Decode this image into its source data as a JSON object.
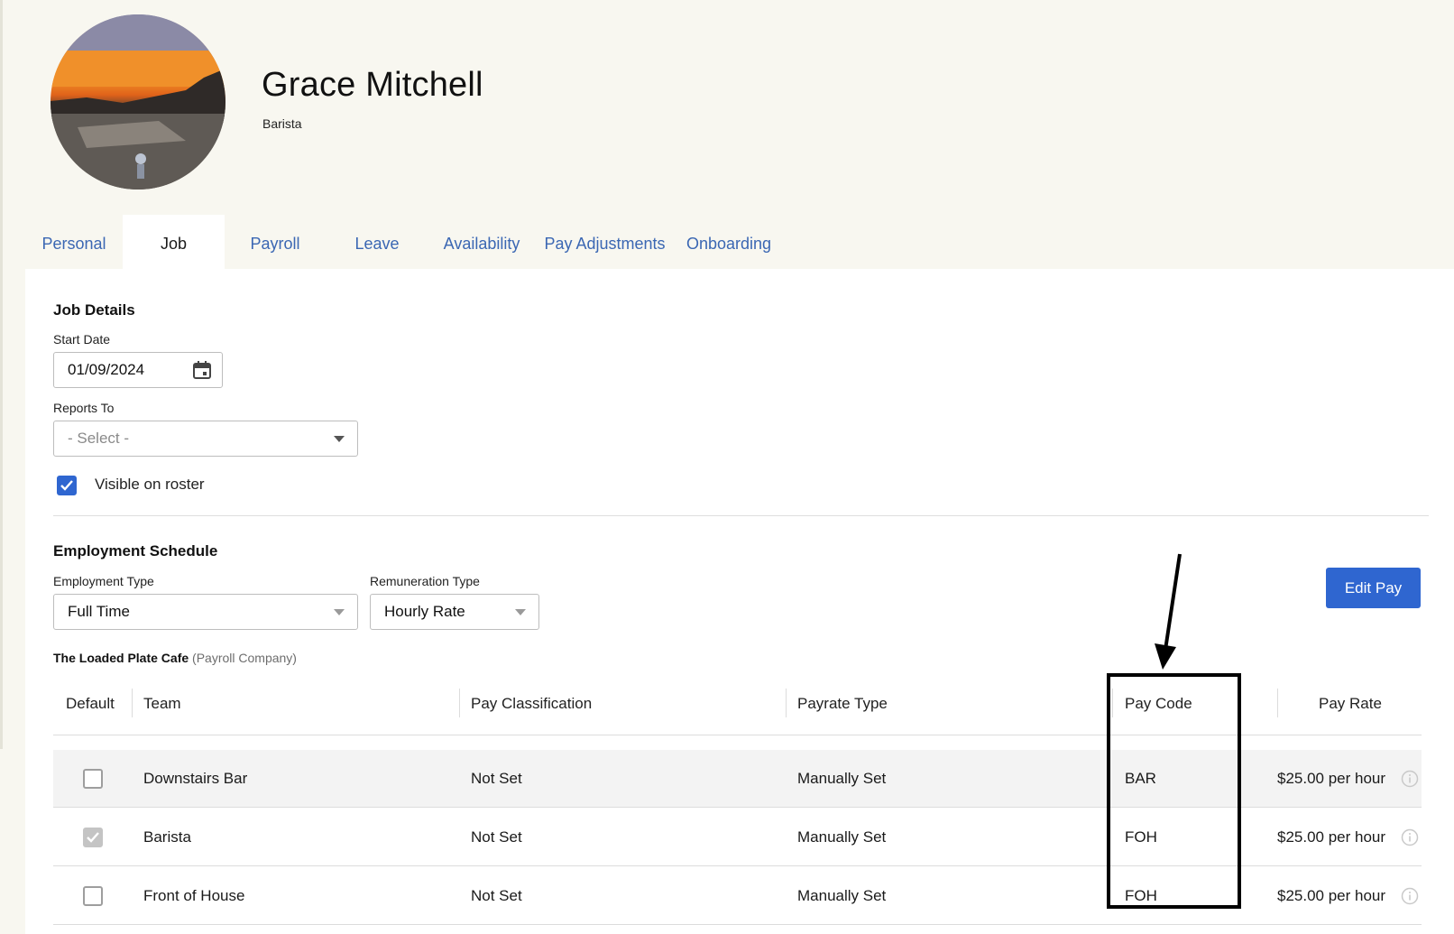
{
  "profile": {
    "name": "Grace Mitchell",
    "role": "Barista",
    "avatar_icon": "camera-add-icon"
  },
  "tabs": [
    {
      "label": "Personal",
      "active": false
    },
    {
      "label": "Job",
      "active": true
    },
    {
      "label": "Payroll",
      "active": false
    },
    {
      "label": "Leave",
      "active": false
    },
    {
      "label": "Availability",
      "active": false
    },
    {
      "label": "Pay Adjustments",
      "active": false
    },
    {
      "label": "Onboarding",
      "active": false
    }
  ],
  "job_details": {
    "title": "Job Details",
    "start_date_label": "Start Date",
    "start_date_value": "01/09/2024",
    "reports_to_label": "Reports To",
    "reports_to_placeholder": "- Select -",
    "visible_on_roster_label": "Visible on roster",
    "visible_on_roster_checked": true
  },
  "employment_schedule": {
    "title": "Employment Schedule",
    "employment_type_label": "Employment Type",
    "employment_type_value": "Full Time",
    "remuneration_type_label": "Remuneration Type",
    "remuneration_type_value": "Hourly Rate",
    "edit_pay_label": "Edit Pay",
    "company_name": "The Loaded Plate Cafe",
    "company_suffix": "(Payroll Company)"
  },
  "table": {
    "headers": {
      "default": "Default",
      "team": "Team",
      "pay_classification": "Pay Classification",
      "payrate_type": "Payrate Type",
      "pay_code": "Pay Code",
      "pay_rate": "Pay Rate"
    },
    "rows": [
      {
        "default": false,
        "default_state": "unchecked",
        "team": "Downstairs Bar",
        "pay_classification": "Not Set",
        "payrate_type": "Manually Set",
        "pay_code": "BAR",
        "pay_rate": "$25.00 per hour"
      },
      {
        "default": true,
        "default_state": "checked-disabled",
        "team": "Barista",
        "pay_classification": "Not Set",
        "payrate_type": "Manually Set",
        "pay_code": "FOH",
        "pay_rate": "$25.00 per hour"
      },
      {
        "default": false,
        "default_state": "unchecked",
        "team": "Front of House",
        "pay_classification": "Not Set",
        "payrate_type": "Manually Set",
        "pay_code": "FOH",
        "pay_rate": "$25.00 per hour"
      }
    ]
  },
  "colors": {
    "accent": "#2f66d0",
    "tab_link": "#3b67b3",
    "page_bg": "#f8f7f0",
    "annotation": "#000000"
  }
}
